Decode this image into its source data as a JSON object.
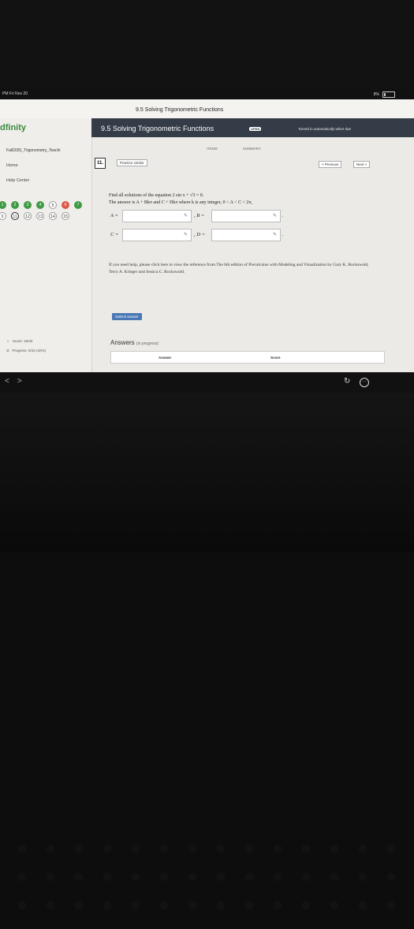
{
  "status_bar": {
    "time": "PM   Fri Nov 20",
    "battery": "8%"
  },
  "browser": {
    "title": "9.5 Solving Trigonometric Functions"
  },
  "sidebar": {
    "logo_main": "dfinity",
    "course": "Fall2020_Trigonometry_Teachi",
    "nav": [
      "Home",
      "Help Center"
    ],
    "question_row1": [
      {
        "num": "1",
        "state": "green"
      },
      {
        "num": "2",
        "state": "green"
      },
      {
        "num": "3",
        "state": "green"
      },
      {
        "num": "4",
        "state": "green"
      },
      {
        "num": "5",
        "state": "plain"
      },
      {
        "num": "6",
        "state": "red"
      },
      {
        "num": "7",
        "state": "green"
      }
    ],
    "question_row2": [
      {
        "num": "0",
        "state": "plain"
      },
      {
        "num": "11",
        "state": "active"
      },
      {
        "num": "12",
        "state": "plain"
      },
      {
        "num": "13",
        "state": "plain"
      },
      {
        "num": "14",
        "state": "plain"
      },
      {
        "num": "15",
        "state": "plain"
      }
    ],
    "score": "Score: 15/40",
    "progress": "Progress: 6/15 (40%)",
    "progress_fraction": 0.4
  },
  "header": {
    "title": "9.5 Solving Trigonometric Functions",
    "badge": "OPEN",
    "notice": "Turned in automatically when due"
  },
  "tabs": {
    "items": "ITEMS",
    "summary": "SUMMARY"
  },
  "question": {
    "number": "11.",
    "practice_label": "Practice similar",
    "prev_label": "< Previous",
    "next_label": "Next >",
    "line1": "Find all solutions of the equation 2 sin x + √3 = 0.",
    "line2": "The answer is A + Bkπ and C + Dkπ where k is any integer, 0 < A < C < 2π,",
    "labels": {
      "a": "A =",
      "b": ", B =",
      "c": "C =",
      "d": ", D ="
    },
    "pencil": "✎",
    "period": "."
  },
  "help": {
    "text": "If you need help, please click here to view the reference from The 6th edition of Precalculus with Modeling and Visualization by Gary K. Rockswold, Terry A. Krieger and Jessica C. Rockswold."
  },
  "submit": {
    "label": "Submit answer"
  },
  "answers": {
    "title": "Answers",
    "status": "(in progress)",
    "col_answer": "Answer",
    "col_score": "Score"
  },
  "bottom_nav": {
    "back": "<",
    "forward": ">",
    "refresh": "↻",
    "more": "···"
  }
}
